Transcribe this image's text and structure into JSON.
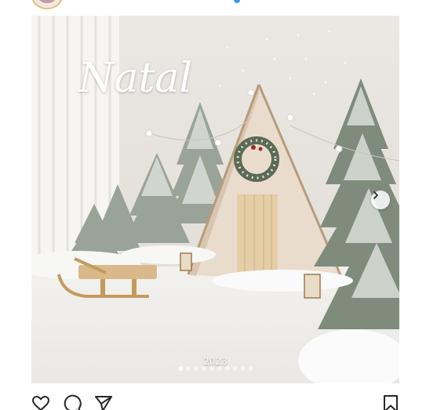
{
  "post": {
    "username": "",
    "image": {
      "title_text": "Natal",
      "year_text": "2023",
      "slide_count": 10,
      "active_slide": 1
    }
  },
  "icons": {
    "next": "chevron-right-icon",
    "like": "heart-icon",
    "comment": "comment-icon",
    "share": "send-icon",
    "save": "bookmark-icon"
  },
  "colors": {
    "accent_blue": "#3897f0",
    "icon_stroke": "#262626"
  }
}
